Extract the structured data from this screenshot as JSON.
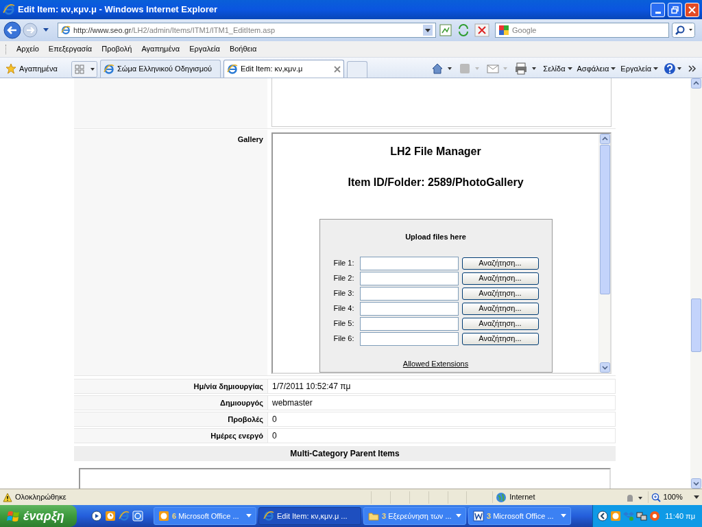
{
  "window": {
    "title": "Edit Item: κν,κμν.μ - Windows Internet Explorer"
  },
  "address_bar": {
    "url_host": "http://www.seo.gr",
    "url_path": "/LH2/admin/Items/ITM1/ITM1_EditItem.asp",
    "search_placeholder": "Google"
  },
  "menu": [
    "Αρχείο",
    "Επεξεργασία",
    "Προβολή",
    "Αγαπημένα",
    "Εργαλεία",
    "Βοήθεια"
  ],
  "favorites": {
    "label": "Αγαπημένα"
  },
  "tabs": [
    {
      "label": "Σώμα Ελληνικού Οδηγισμού",
      "selected": false
    },
    {
      "label": "Edit Item: κν,κμν.μ",
      "selected": true
    }
  ],
  "command_bar": [
    "Σελίδα",
    "Ασφάλεια",
    "Εργαλεία"
  ],
  "form": {
    "gallery_label": "Gallery",
    "file_manager": {
      "title": "LH2 File Manager",
      "folder": "Item ID/Folder: 2589/PhotoGallery",
      "upload_title": "Upload files here",
      "files": [
        {
          "label": "File 1:",
          "button": "Αναζήτηση..."
        },
        {
          "label": "File 2:",
          "button": "Αναζήτηση..."
        },
        {
          "label": "File 3:",
          "button": "Αναζήτηση..."
        },
        {
          "label": "File 4:",
          "button": "Αναζήτηση..."
        },
        {
          "label": "File 5:",
          "button": "Αναζήτηση..."
        },
        {
          "label": "File 6:",
          "button": "Αναζήτηση..."
        }
      ],
      "extensions_link": "Allowed Extensions"
    },
    "fields": [
      {
        "label": "Ημ/νία δημιουργίας",
        "value": "1/7/2011 10:52:47 πμ"
      },
      {
        "label": "Δημιουργός",
        "value": "webmaster"
      },
      {
        "label": "Προβολές",
        "value": "0"
      },
      {
        "label": "Ημέρες ενεργό",
        "value": "0"
      }
    ],
    "section_header": "Multi-Category Parent Items"
  },
  "status_bar": {
    "text": "Ολοκληρώθηκε",
    "zone": "Internet",
    "zoom": "100%"
  },
  "taskbar": {
    "start": "έναρξη",
    "buttons": [
      {
        "count": "6",
        "label": "Microsoft Office ...",
        "selected": false,
        "kind": "office"
      },
      {
        "label": "Edit Item: κν,κμν.μ ...",
        "selected": true,
        "kind": "ie"
      },
      {
        "count": "3",
        "label": "Εξερεύνηση των ...",
        "selected": false,
        "kind": "folder"
      },
      {
        "count": "3",
        "label": "Microsoft Office ...",
        "selected": false,
        "kind": "word"
      }
    ],
    "clock": "11:40 πμ"
  }
}
